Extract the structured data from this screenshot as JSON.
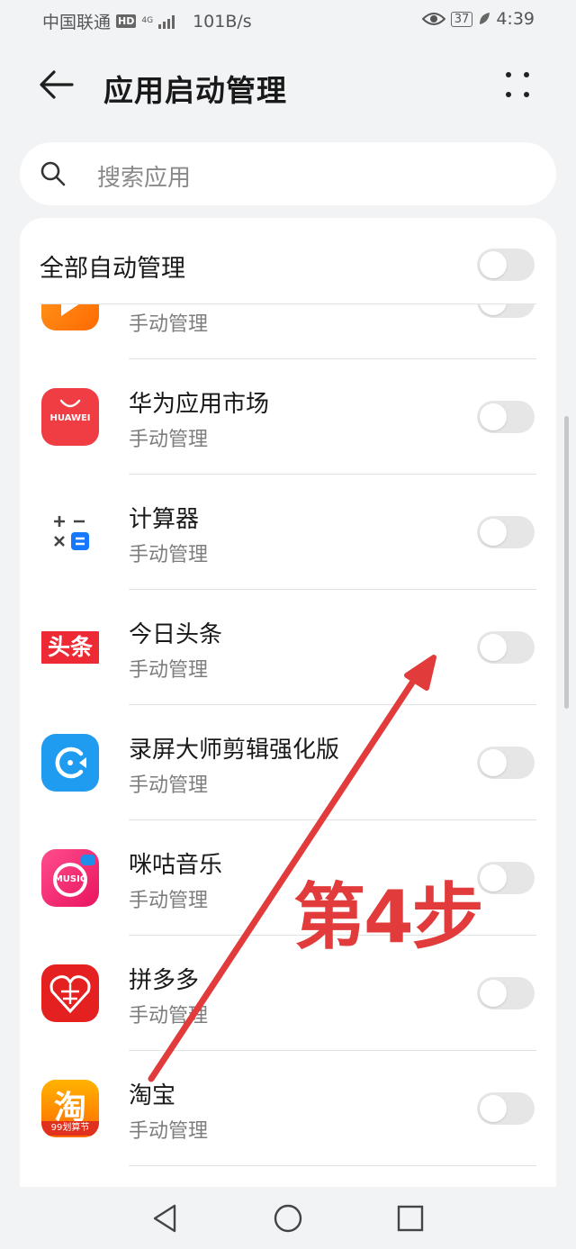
{
  "status_bar": {
    "carrier": "中国联通",
    "hd": "HD",
    "network": "4G",
    "speed": "101B/s",
    "battery": "37",
    "time": "4:39"
  },
  "header": {
    "title": "应用启动管理"
  },
  "search": {
    "placeholder": "搜索应用"
  },
  "all_toggle": {
    "label": "全部自动管理",
    "on": false
  },
  "apps": [
    {
      "name": "",
      "status": "手动管理",
      "icon": "video-app-icon",
      "on": false
    },
    {
      "name": "华为应用市场",
      "status": "手动管理",
      "icon": "huawei-appgallery-icon",
      "icon_text": "HUAWEI",
      "on": false
    },
    {
      "name": "计算器",
      "status": "手动管理",
      "icon": "calculator-icon",
      "on": false
    },
    {
      "name": "今日头条",
      "status": "手动管理",
      "icon": "toutiao-icon",
      "icon_text": "头条",
      "on": false
    },
    {
      "name": "录屏大师剪辑强化版",
      "status": "手动管理",
      "icon": "screen-recorder-icon",
      "on": false
    },
    {
      "name": "咪咕音乐",
      "status": "手动管理",
      "icon": "migu-music-icon",
      "icon_text": "MUSIC",
      "on": false
    },
    {
      "name": "拼多多",
      "status": "手动管理",
      "icon": "pinduoduo-icon",
      "on": false
    },
    {
      "name": "淘宝",
      "status": "手动管理",
      "icon": "taobao-icon",
      "icon_text": "淘",
      "icon_subtext": "99划算节",
      "on": false
    }
  ],
  "annotation": {
    "step_label": "第4步",
    "color": "#e23b3b"
  },
  "colors": {
    "background": "#f1f3f5",
    "card": "#ffffff",
    "toggle_off": "#e6e6e6"
  }
}
